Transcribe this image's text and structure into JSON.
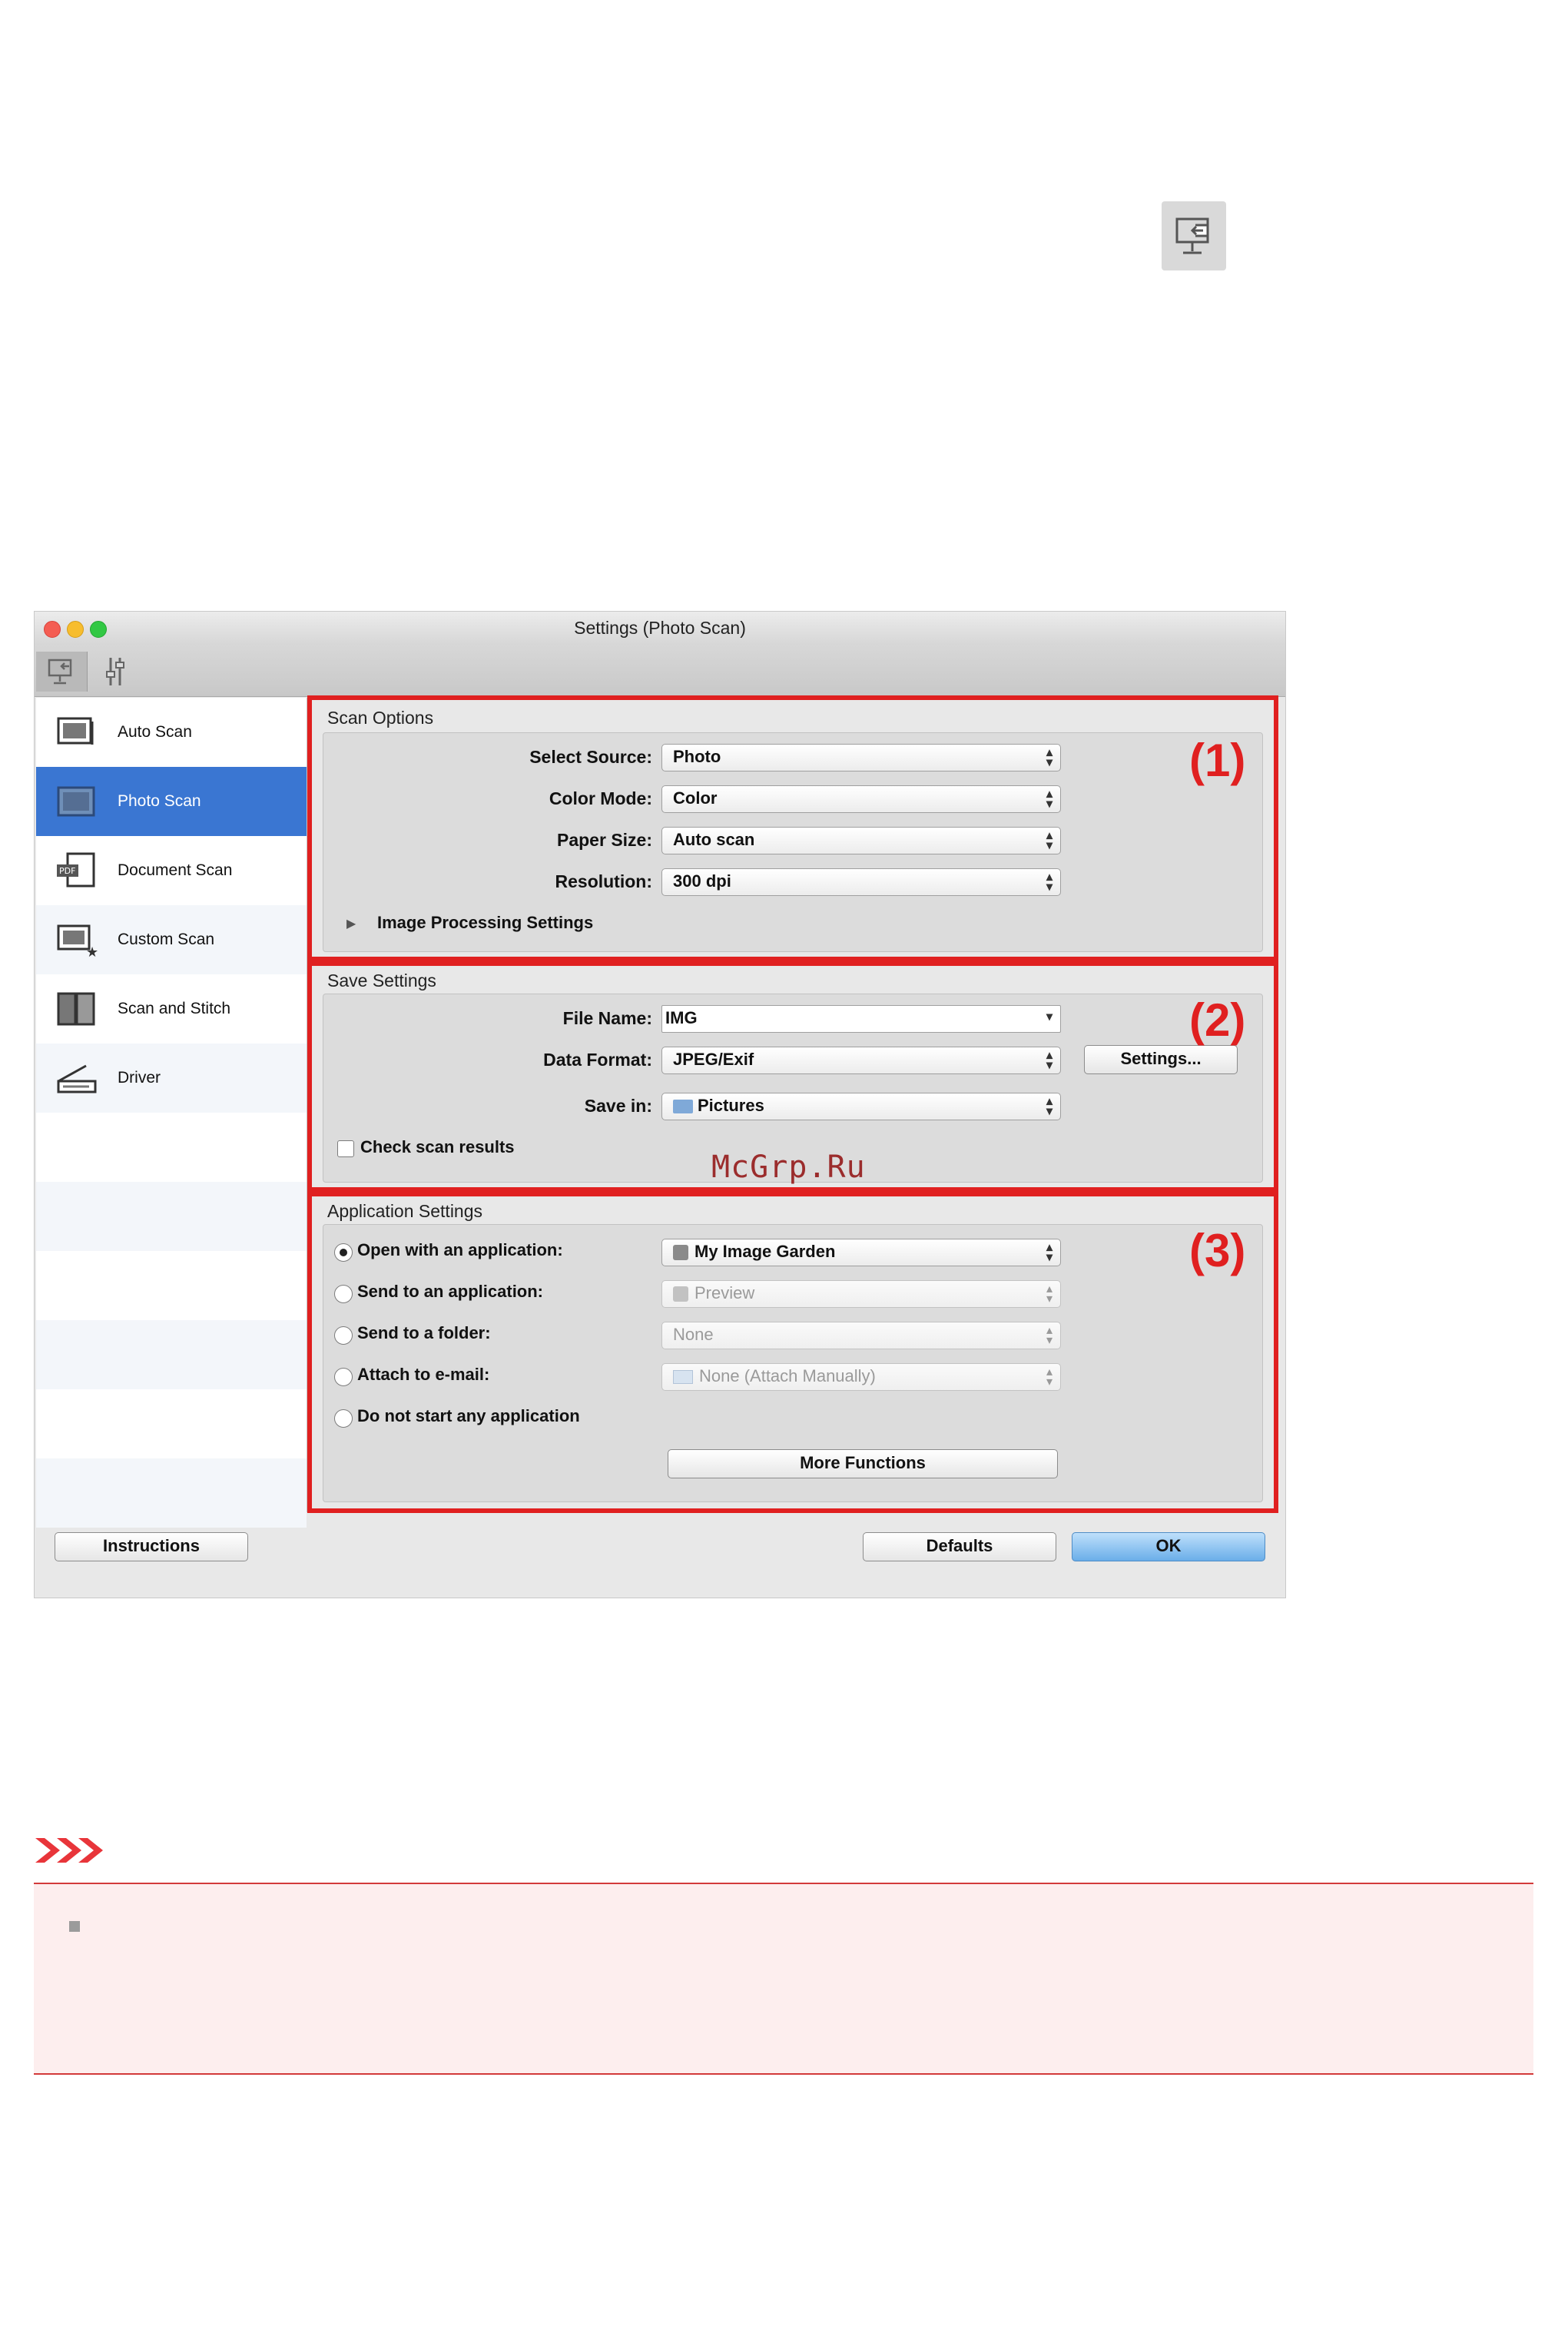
{
  "window": {
    "title": "Settings (Photo Scan)",
    "toolbar_icons": [
      "scan-icon",
      "general-settings-icon"
    ]
  },
  "sidebar": {
    "items": [
      {
        "label": "Auto Scan",
        "icon": "auto-scan-icon",
        "active": false
      },
      {
        "label": "Photo Scan",
        "icon": "photo-scan-icon",
        "active": true
      },
      {
        "label": "Document Scan",
        "icon": "document-scan-icon",
        "active": false
      },
      {
        "label": "Custom Scan",
        "icon": "custom-scan-icon",
        "active": false
      },
      {
        "label": "Scan and Stitch",
        "icon": "scan-stitch-icon",
        "active": false
      },
      {
        "label": "Driver",
        "icon": "driver-icon",
        "active": false
      }
    ]
  },
  "scan_options": {
    "title": "Scan Options",
    "marker": "(1)",
    "select_source": {
      "label": "Select Source:",
      "value": "Photo"
    },
    "color_mode": {
      "label": "Color Mode:",
      "value": "Color"
    },
    "paper_size": {
      "label": "Paper Size:",
      "value": "Auto scan"
    },
    "resolution": {
      "label": "Resolution:",
      "value": "300 dpi"
    },
    "image_processing": "Image Processing Settings"
  },
  "save_settings": {
    "title": "Save Settings",
    "marker": "(2)",
    "file_name": {
      "label": "File Name:",
      "value": "IMG"
    },
    "data_format": {
      "label": "Data Format:",
      "value": "JPEG/Exif"
    },
    "settings_button": "Settings...",
    "save_in": {
      "label": "Save in:",
      "value": "Pictures"
    },
    "check_scan_results": "Check scan results"
  },
  "app_settings": {
    "title": "Application Settings",
    "marker": "(3)",
    "options": [
      {
        "label": "Open with an application:",
        "value": "My Image Garden",
        "selected": true,
        "disabled": false
      },
      {
        "label": "Send to an application:",
        "value": "Preview",
        "selected": false,
        "disabled": true
      },
      {
        "label": "Send to a folder:",
        "value": "None",
        "selected": false,
        "disabled": true
      },
      {
        "label": "Attach to e-mail:",
        "value": "None (Attach Manually)",
        "selected": false,
        "disabled": true
      },
      {
        "label": "Do not start any application",
        "value": "",
        "selected": false,
        "disabled": false
      }
    ],
    "more_functions": "More Functions"
  },
  "footer": {
    "instructions": "Instructions",
    "defaults": "Defaults",
    "ok": "OK"
  },
  "watermark": "McGrp.Ru",
  "colors": {
    "highlight_red": "#e02020",
    "selected_blue": "#3a76d2",
    "note_bg": "#fdeeee"
  }
}
